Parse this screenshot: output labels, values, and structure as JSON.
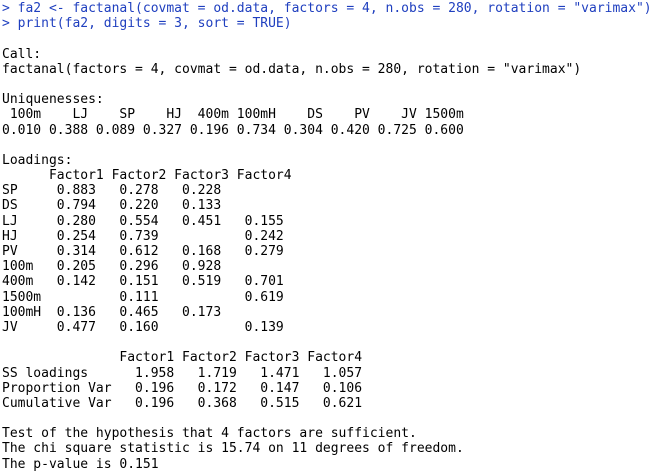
{
  "console": {
    "prompt_color": "#1f3fbf",
    "output_color": "#000000",
    "commands": [
      "> fa2 <- factanal(covmat = od.data, factors = 4, n.obs = 280, rotation = \"varimax\")",
      "> print(fa2, digits = 3, sort = TRUE)"
    ],
    "call": {
      "header": "Call:",
      "text": "factanal(factors = 4, covmat = od.data, n.obs = 280, rotation = \"varimax\")"
    },
    "uniquenesses": {
      "header": "Uniquenesses:",
      "names_row": " 100m    LJ    SP    HJ  400m 100mH    DS    PV    JV 1500m ",
      "values_row": "0.010 0.388 0.089 0.327 0.196 0.734 0.304 0.420 0.725 0.600 "
    },
    "loadings": {
      "header": "Loadings:",
      "rows": [
        "      Factor1 Factor2 Factor3 Factor4",
        "SP     0.883   0.278   0.228        ",
        "DS     0.794   0.220   0.133        ",
        "LJ     0.280   0.554   0.451   0.155",
        "HJ     0.254   0.739           0.242",
        "PV     0.314   0.612   0.168   0.279",
        "100m   0.205   0.296   0.928        ",
        "400m   0.142   0.151   0.519   0.701",
        "1500m          0.111           0.619",
        "100mH  0.136   0.465   0.173        ",
        "JV     0.477   0.160           0.139"
      ]
    },
    "variance": {
      "rows": [
        "               Factor1 Factor2 Factor3 Factor4",
        "SS loadings      1.958   1.719   1.471   1.057",
        "Proportion Var   0.196   0.172   0.147   0.106",
        "Cumulative Var   0.196   0.368   0.515   0.621"
      ]
    },
    "test": {
      "rows": [
        "Test of the hypothesis that 4 factors are sufficient.",
        "The chi square statistic is 15.74 on 11 degrees of freedom.",
        "The p-value is 0.151"
      ]
    }
  }
}
